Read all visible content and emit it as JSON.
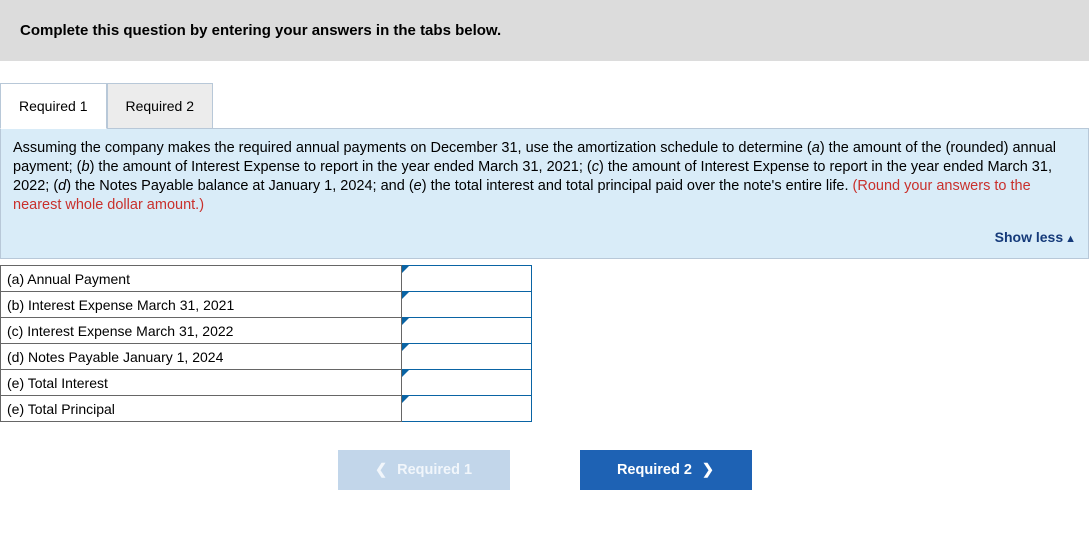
{
  "banner": "Complete this question by entering your answers in the tabs below.",
  "tabs": [
    {
      "label": "Required 1",
      "active": true
    },
    {
      "label": "Required 2",
      "active": false
    }
  ],
  "instructions": {
    "part1": "Assuming the company makes the required annual payments on December 31, use the amortization schedule to determine (",
    "a": "a",
    "part2": ") the amount of the (rounded) annual payment; (",
    "b": "b",
    "part3": ") the amount of Interest Expense to report in the year ended March 31, 2021; (",
    "c": "c",
    "part4": ") the amount of Interest Expense to report in the year ended March 31, 2022; (",
    "d": "d",
    "part5": ") the Notes Payable balance at January 1, 2024; and (",
    "e": "e",
    "part6": ") the total interest and total principal paid over the note's entire life. ",
    "round_note": "(Round your answers to the nearest whole dollar amount.)"
  },
  "show_less": "Show less",
  "rows": [
    {
      "label": "(a) Annual Payment",
      "value": ""
    },
    {
      "label": "(b) Interest Expense March 31, 2021",
      "value": ""
    },
    {
      "label": "(c) Interest Expense March 31, 2022",
      "value": ""
    },
    {
      "label": "(d) Notes Payable January 1, 2024",
      "value": ""
    },
    {
      "label": "(e) Total Interest",
      "value": ""
    },
    {
      "label": "(e) Total Principal",
      "value": ""
    }
  ],
  "nav": {
    "prev": "Required 1",
    "next": "Required 2"
  }
}
